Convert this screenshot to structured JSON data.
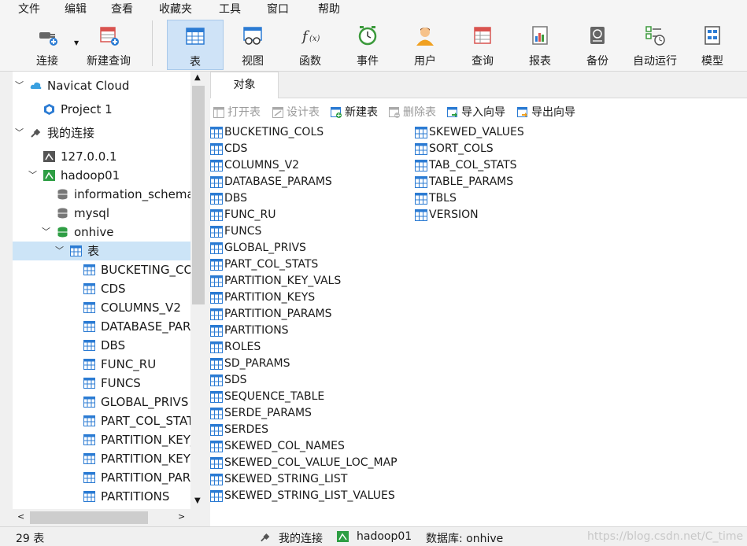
{
  "menu": [
    "文件",
    "编辑",
    "查看",
    "收藏夹",
    "工具",
    "窗口",
    "帮助"
  ],
  "toolbar": {
    "connect": "连接",
    "new_query": "新建查询",
    "table": "表",
    "view": "视图",
    "function": "函数",
    "event": "事件",
    "user": "用户",
    "query": "查询",
    "report": "报表",
    "backup": "备份",
    "auto_run": "自动运行",
    "model": "模型"
  },
  "tree": {
    "navicat_cloud": "Navicat Cloud",
    "project": "Project 1",
    "my_connections": "我的连接",
    "conn_local": "127.0.0.1",
    "conn_hadoop": "hadoop01",
    "db_info": "information_schema",
    "db_mysql": "mysql",
    "db_onhive": "onhive",
    "tables_node": "表",
    "tables": [
      "BUCKETING_COLS",
      "CDS",
      "COLUMNS_V2",
      "DATABASE_PARAMS",
      "DBS",
      "FUNC_RU",
      "FUNCS",
      "GLOBAL_PRIVS",
      "PART_COL_STATS",
      "PARTITION_KEY_VALS",
      "PARTITION_KEYS",
      "PARTITION_PARAMS",
      "PARTITIONS"
    ]
  },
  "tab": {
    "objects": "对象"
  },
  "obj_toolbar": {
    "open": "打开表",
    "design": "设计表",
    "new": "新建表",
    "delete": "删除表",
    "import": "导入向导",
    "export": "导出向导"
  },
  "objects": {
    "col1": [
      "BUCKETING_COLS",
      "CDS",
      "COLUMNS_V2",
      "DATABASE_PARAMS",
      "DBS",
      "FUNC_RU",
      "FUNCS",
      "GLOBAL_PRIVS",
      "PART_COL_STATS",
      "PARTITION_KEY_VALS",
      "PARTITION_KEYS",
      "PARTITION_PARAMS",
      "PARTITIONS",
      "ROLES",
      "SD_PARAMS",
      "SDS",
      "SEQUENCE_TABLE",
      "SERDE_PARAMS",
      "SERDES",
      "SKEWED_COL_NAMES",
      "SKEWED_COL_VALUE_LOC_MAP",
      "SKEWED_STRING_LIST",
      "SKEWED_STRING_LIST_VALUES"
    ],
    "col2": [
      "SKEWED_VALUES",
      "SORT_COLS",
      "TAB_COL_STATS",
      "TABLE_PARAMS",
      "TBLS",
      "VERSION"
    ]
  },
  "status": {
    "count": "29 表",
    "connection": "我的连接",
    "server": "hadoop01",
    "database": "数据库: onhive",
    "watermark": "https://blog.csdn.net/C_time"
  },
  "colors": {
    "accent": "#2b7bd3",
    "selection": "#cce4f7",
    "toolbar_active": "#cfe3f7"
  }
}
